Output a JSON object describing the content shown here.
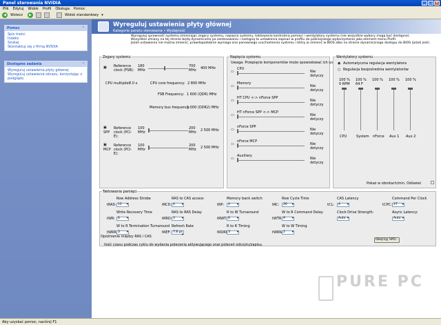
{
  "window": {
    "title": "Panel sterowania NVIDIA"
  },
  "menu": [
    "Plik",
    "Edytuj",
    "Widok",
    "Profil",
    "Obsługa",
    "Pomoc"
  ],
  "toolbar": {
    "back": "Wstecz",
    "view": "Widok standardowy"
  },
  "sidebar": {
    "help_title": "Pomoc",
    "help_items": [
      "Spis treści",
      "Indeks",
      "Szukaj",
      "Skontaktuj się z firmą NVIDIA"
    ],
    "tasks_title": "Dostępne zadania",
    "tasks": [
      "Wyreguluj ustawienia płyty głównej",
      "Wyreguluj ustawienia obrazu, korzystając z podglądu"
    ]
  },
  "header": {
    "title": "Wyreguluj ustawienia płyty głównej",
    "subtitle": "Kategorie panelu sterowania  •  Wydajność"
  },
  "description": [
    "Wyreguluj sprawność systemu zmieniając zegary systemu, napięcia systemu, taktowania kontrolera pamięci i wentylatory systemu (nie wszystkie wybory mogą być dostępne).",
    "Wszystkie zmiany na tej stronie będą dynamicznie po zastosowaniu i nastąpią te ustawienia zapisać w profilu do późniejszego wykorzystania jako element menu Profil.",
    "Jeżeli ustawienia nie można zmienić, prawdopodobnie wymaga ono ponownego uruchomienia systemu i który je zmienić w BIOS albo na stronie dynamicznego dostępu do BIOS (jeżeli jest)."
  ],
  "clocks": {
    "title": "Zegary systemu",
    "ref_label": "Reference clock (FSB):",
    "ref_min": "180 MHz",
    "ref_max": "700 MHz",
    "ref_val": "400 MHz",
    "cpu_mult_label": "CPU multiplier:",
    "cpu_mult": "7.0 x",
    "core_label": "CPU core frequency:",
    "core_val": "2 800 MHz",
    "fsb_label": "FSB Frequency:",
    "fsb_val": "1 600 (QDR) MHz",
    "mem_label": "Memory bus frequency:",
    "mem_val": "1 000 (DDR2) MHz",
    "spp_tag": "SPP",
    "spp_label": "Reference clock (PCI-E):",
    "spp_min": "100 MHz",
    "spp_max": "200 MHz",
    "spp_val": "2 500 MHz",
    "mcp_tag": "MCP",
    "mcp_label": "Reference clock (PCI-E):",
    "mcp_min": "100 MHz",
    "mcp_max": "200 MHz",
    "mcp_val": "2 500 MHz"
  },
  "voltages": {
    "title": "Napięcia systemu",
    "warning": "Uwaga: Przepięcie komponentów może spowodować ich uszkodzenie.",
    "items": [
      {
        "name": "CPU",
        "value": "Nie dotyczy"
      },
      {
        "name": "Memory",
        "value": "Nie dotyczy"
      },
      {
        "name": "HT CPU <-> nForce SPP",
        "value": "Nie dotyczy"
      },
      {
        "name": "HT nForce SPP <-> MCP",
        "value": "Nie dotyczy"
      },
      {
        "name": "nForce SPP",
        "value": "Nie dotyczy"
      },
      {
        "name": "nForce MCP",
        "value": "Nie dotyczy"
      },
      {
        "name": "Auxiliary",
        "value": "Nie dotyczy"
      }
    ]
  },
  "fans": {
    "title": "Wentylatory systemu",
    "auto": "Automatyczna regulacja wentylatora",
    "direct": "Regulacja bezpośrednia wentylatorów",
    "pct": [
      "100 %",
      "100 %",
      "100 %",
      "100 %",
      "100 %"
    ],
    "rpm": [
      "0 RPM",
      "64 F",
      "",
      "",
      ""
    ],
    "labels": [
      "CPU",
      "System",
      "nForce",
      "Aux 1",
      "Aux 2"
    ],
    "show_rpm": "Pokaż w obrotach/min. Odśwież"
  },
  "timings": {
    "title": "Taktowania pamięci",
    "fields": [
      {
        "label": "Row Address Strobe",
        "code": "tRAS:",
        "value": "12"
      },
      {
        "label": "RAS to CAS access",
        "code": "tRCD:",
        "value": "4"
      },
      {
        "label": "Memory bank switch",
        "code": "tRP:",
        "value": "4"
      },
      {
        "label": "Row Cycle Time",
        "code": "tRC:",
        "value": "26"
      },
      {
        "label": "CAS Latency",
        "code": "tCL:",
        "value": "4"
      },
      {
        "label": "Command Per Clock",
        "code": "tCPC:",
        "value": "2T"
      },
      {
        "label": "Write Recovery Time",
        "code": "tWR:",
        "value": "6"
      },
      {
        "label": "RAS to RAS Delay",
        "code": "tRRD:",
        "value": "3"
      },
      {
        "label": "R to W Turnaround",
        "code": "tRWT:",
        "value": "6"
      },
      {
        "label": "W to R Command Delay",
        "code": "tWTR:",
        "value": "9"
      },
      {
        "label": "Clock Drive Strength:",
        "code": "",
        "value": "Auto"
      },
      {
        "label": "Async Latency:",
        "code": "",
        "value": "Auto"
      },
      {
        "label": "W to R Termination Turnaround",
        "code": "tWRRD:",
        "value": "3"
      },
      {
        "label": "Refresh Rate",
        "code": "tREF:",
        "value": "7.8 µs"
      },
      {
        "label": "R to R Timing",
        "code": "tRDRD:",
        "value": "3"
      },
      {
        "label": "W to W Timing",
        "code": "tWRWR:",
        "value": "2"
      }
    ],
    "spd_button": "Obejrzyj SPD..."
  },
  "info": {
    "title": "Opóźnienie między RAS i CAS",
    "body": "Ilość czasu podczas cyklu do wydania polecenia aktywującego oraz poleceń odczytu/zapisu."
  },
  "status": "Aby uzyskać pomoc, naciśnij F1",
  "watermark": "PURE PC"
}
